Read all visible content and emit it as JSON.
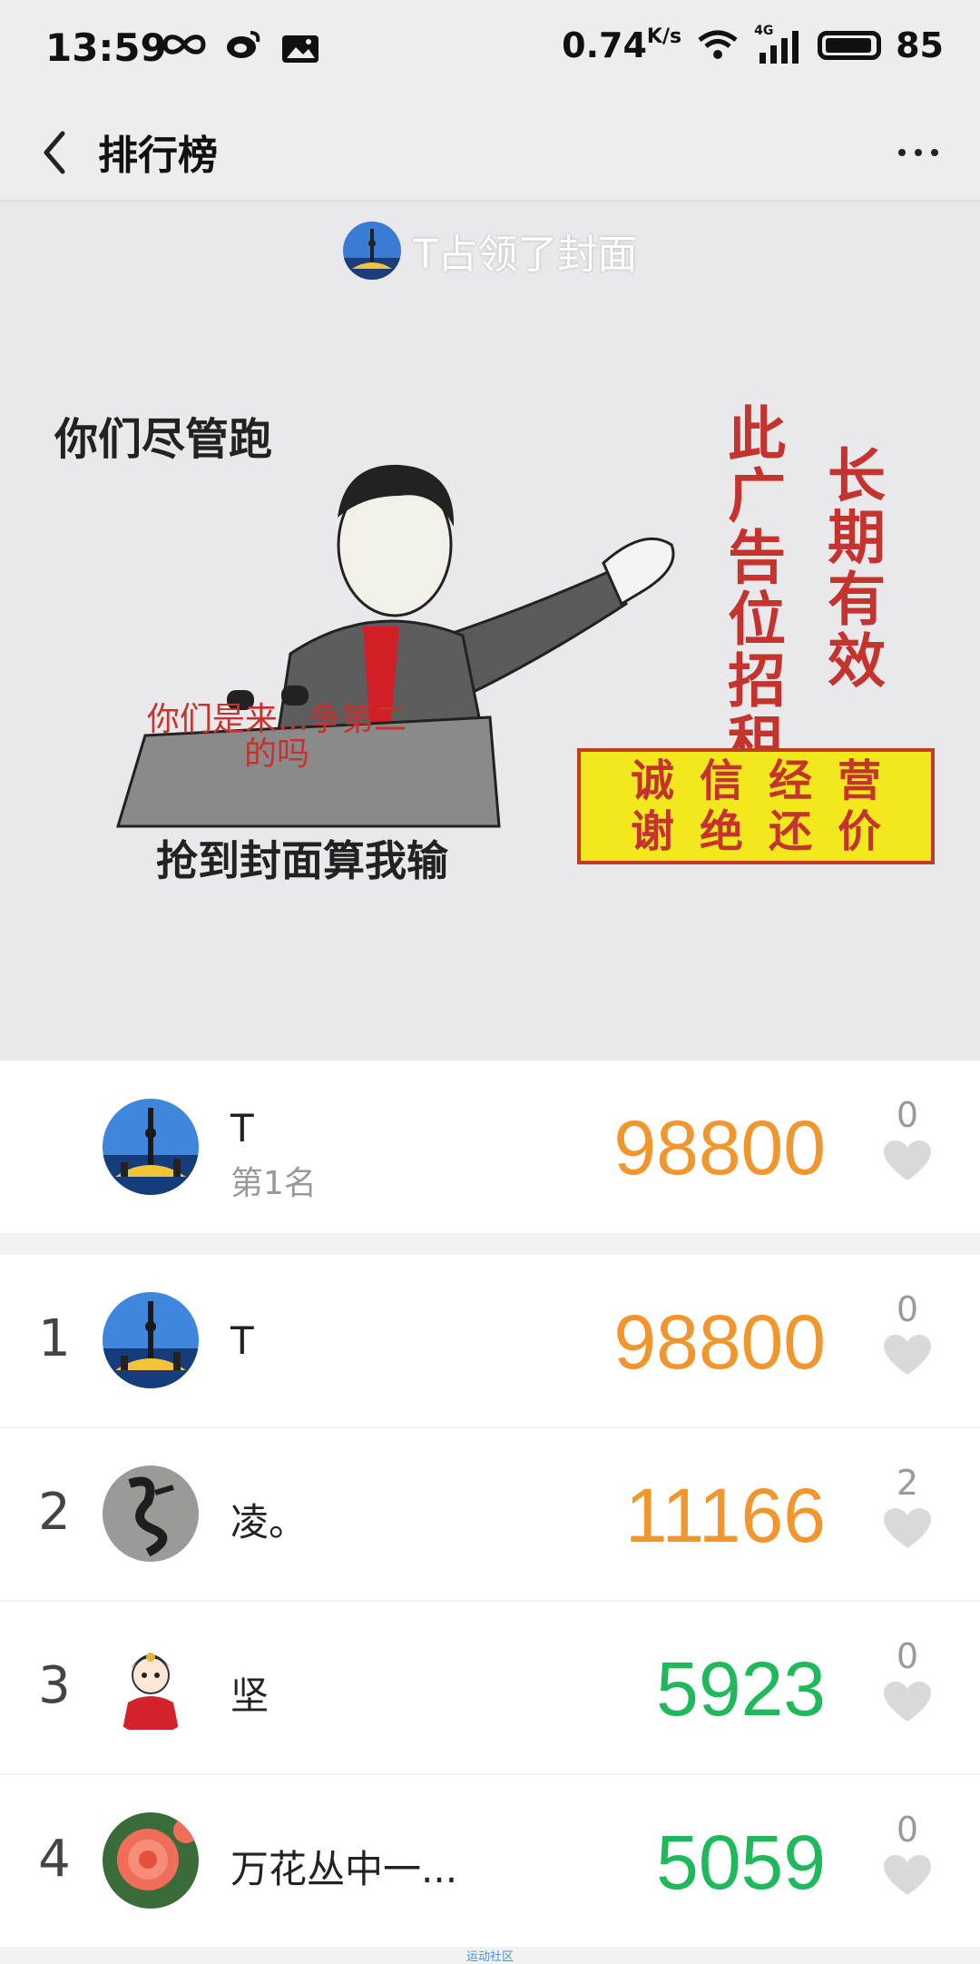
{
  "status_bar": {
    "time": "13:59",
    "speed": "0.74",
    "speed_unit": "K/s",
    "network": "4G",
    "battery": "85"
  },
  "nav": {
    "title": "排行榜"
  },
  "cover": {
    "owner_text": "T占领了封面",
    "meme": {
      "top_left": "你们尽管跑",
      "podium": "你们是来...争第二的吗",
      "bottom": "抢到封面算我输",
      "vertical_1": "此广告位招租",
      "vertical_2": "长期有效",
      "banner_line1": "诚信经营",
      "banner_line2": "谢绝还价"
    }
  },
  "my_entry": {
    "name": "T",
    "rank_label": "第1名",
    "score": "98800",
    "likes": "0",
    "score_color": "#f0962d"
  },
  "leaderboard": [
    {
      "rank": "1",
      "name": "T",
      "score": "98800",
      "likes": "0",
      "score_color": "#f0962d"
    },
    {
      "rank": "2",
      "name": "凌。",
      "score": "11166",
      "likes": "2",
      "score_color": "#f0962d"
    },
    {
      "rank": "3",
      "name": "坚",
      "score": "5923",
      "likes": "0",
      "score_color": "#1fb85a"
    },
    {
      "rank": "4",
      "name": "万花丛中一...",
      "score": "5059",
      "likes": "0",
      "score_color": "#1fb85a"
    }
  ],
  "footer": "运动社区"
}
